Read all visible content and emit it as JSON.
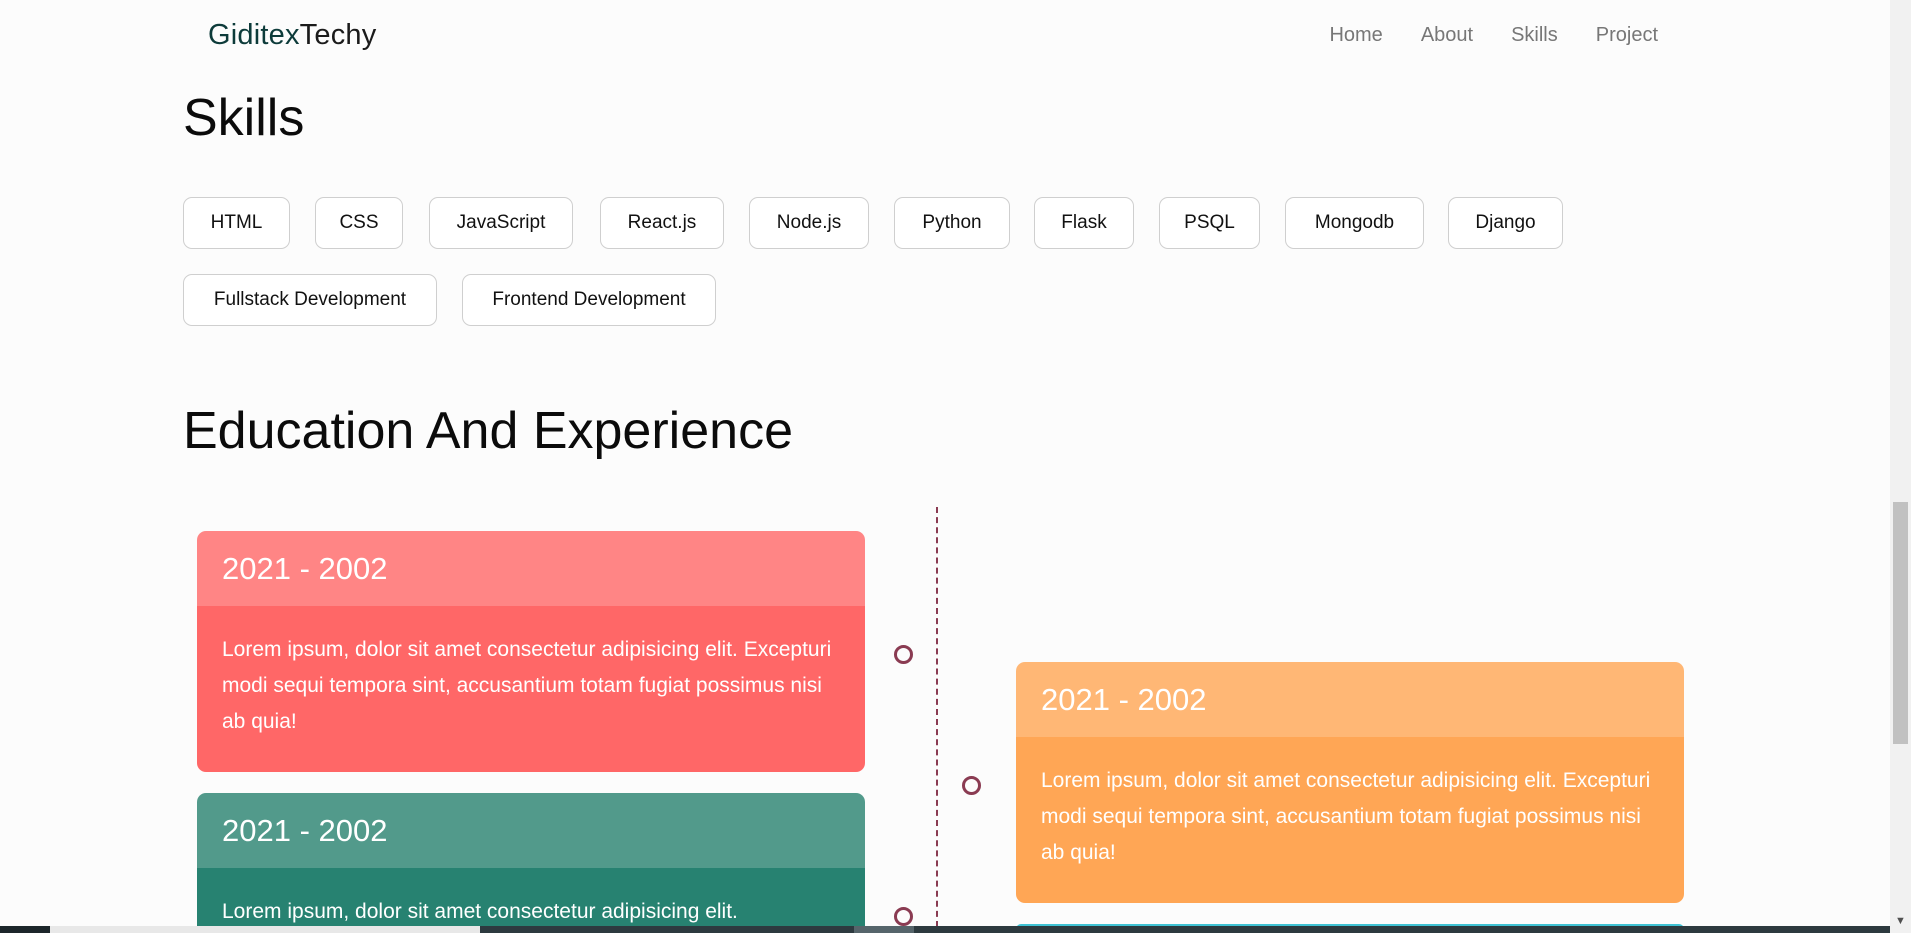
{
  "brand": {
    "part1": "Giditex",
    "part2": "Techy"
  },
  "nav": [
    "Home",
    "About",
    "Skills",
    "Project"
  ],
  "skills_title": "Skills",
  "skills": [
    "HTML",
    "CSS",
    "JavaScript",
    "React.js",
    "Node.js",
    "Python",
    "Flask",
    "PSQL",
    "Mongodb",
    "Django",
    "Fullstack Development",
    "Frontend Development"
  ],
  "edu_title": "Education And Experience",
  "timeline": [
    {
      "years": "2021 - 2002",
      "text": "Lorem ipsum, dolor sit amet consectetur adipisicing elit. Excepturi modi sequi tempora sint, accusantium totam fugiat possimus nisi ab quia!",
      "color": "#ff6767"
    },
    {
      "years": "2021 - 2002",
      "text": "Lorem ipsum, dolor sit amet consectetur adipisicing elit. Excepturi modi sequi tempora sint, accusantium totam fugiat possimus nisi ab quia!",
      "color": "#ffa655"
    },
    {
      "years": "2021 - 2002",
      "text": "Lorem ipsum, dolor sit amet consectetur adipisicing elit.",
      "color": "#278271"
    }
  ],
  "colors": {
    "timeline_accent": "#8a3b52",
    "brand_accent": "#0d3b3a"
  }
}
